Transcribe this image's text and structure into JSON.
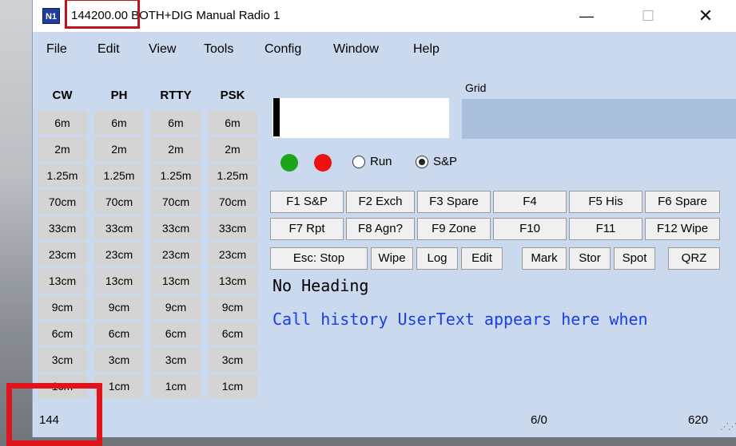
{
  "window": {
    "frequency": "144200.00",
    "title_rest": "BOTH+DIG Manual Radio 1",
    "icon_text": "N1",
    "controls": {
      "minimize": "—",
      "maximize": "☐",
      "close": "✕"
    }
  },
  "menu": [
    {
      "label": "File"
    },
    {
      "label": "Edit"
    },
    {
      "label": "View"
    },
    {
      "label": "Tools"
    },
    {
      "label": "Config"
    },
    {
      "label": "Window"
    },
    {
      "label": "Help"
    }
  ],
  "bands": {
    "headers": [
      "CW",
      "PH",
      "RTTY",
      "PSK"
    ],
    "rows": [
      "6m",
      "2m",
      "1.25m",
      "70cm",
      "33cm",
      "23cm",
      "13cm",
      "9cm",
      "6cm",
      "3cm",
      "1cm"
    ]
  },
  "grid_label": "Grid",
  "radio": {
    "run_label": "Run",
    "sp_label": "S&P",
    "selected": "S&P"
  },
  "function_keys": [
    [
      "F1 S&P",
      "F2 Exch",
      "F3 Spare",
      "F4",
      "F5 His",
      "F6 Spare"
    ],
    [
      "F7 Rpt",
      "F8 Agn?",
      "F9 Zone",
      "F10",
      "F11",
      "F12 Wipe"
    ]
  ],
  "action_buttons": [
    "Esc: Stop",
    "Wipe",
    "Log",
    "Edit",
    "Mark",
    "Stor",
    "Spot",
    "QRZ"
  ],
  "heading_text": "No Heading",
  "call_history_text": "Call history UserText appears here when",
  "status": {
    "left": "144",
    "middle": "6/0",
    "right": "620"
  },
  "colors": {
    "window_bg": "#cad9ee",
    "grid_field": "#a9bfdb",
    "green_dot": "#1aa51a",
    "red_dot": "#ef1010",
    "call_history": "#1a3de6",
    "highlight": "#e0141c"
  }
}
